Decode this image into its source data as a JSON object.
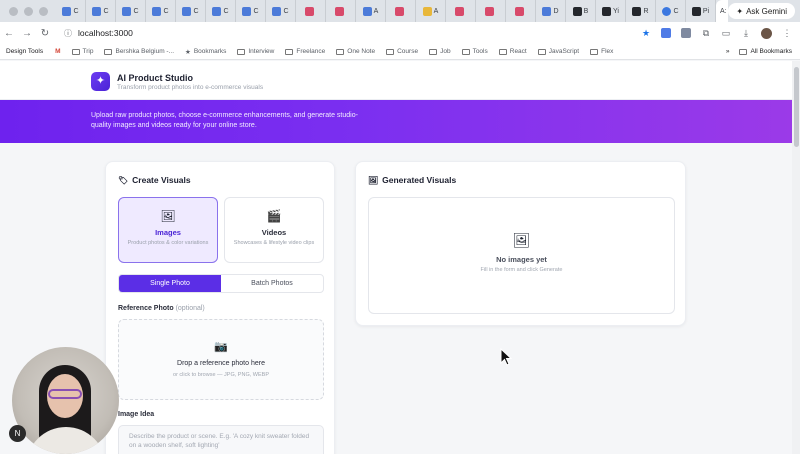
{
  "browser": {
    "tabs": [
      {
        "label": "C",
        "icon": "docs-icon"
      },
      {
        "label": "C",
        "icon": "docs-icon"
      },
      {
        "label": "C",
        "icon": "docs-icon"
      },
      {
        "label": "C",
        "icon": "docs-icon"
      },
      {
        "label": "C",
        "icon": "docs-icon"
      },
      {
        "label": "C",
        "icon": "docs-icon"
      },
      {
        "label": "C",
        "icon": "docs-icon"
      },
      {
        "label": "C",
        "icon": "docs-icon"
      },
      {
        "label": "",
        "icon": "video-icon"
      },
      {
        "label": "",
        "icon": "video-icon"
      },
      {
        "label": "A",
        "icon": "docs-icon"
      },
      {
        "label": "",
        "icon": "video-icon"
      },
      {
        "label": "A",
        "icon": "slides-icon"
      },
      {
        "label": "",
        "icon": "video-icon"
      },
      {
        "label": "",
        "icon": "video-icon"
      },
      {
        "label": "",
        "icon": "video-icon"
      },
      {
        "label": "D",
        "icon": "docs-icon"
      },
      {
        "label": "B",
        "icon": "docs-icon"
      },
      {
        "label": "Yi",
        "icon": "app-icon"
      },
      {
        "label": "R",
        "icon": "app-icon"
      },
      {
        "label": "C",
        "icon": "chrome-icon"
      },
      {
        "label": "Pi",
        "icon": "app-icon"
      }
    ],
    "active_tab": "A:",
    "new_tab": "+",
    "ask_gemini": "Ask Gemini",
    "url": "localhost:3000",
    "bookmarks": [
      {
        "label": "Trip"
      },
      {
        "label": "Bershka Belgium -..."
      },
      {
        "label": "Bookmarks"
      },
      {
        "label": "Interview"
      },
      {
        "label": "Freelance"
      },
      {
        "label": "One Note"
      },
      {
        "label": "Course"
      },
      {
        "label": "Job"
      },
      {
        "label": "Tools"
      },
      {
        "label": "React"
      },
      {
        "label": "JavaScript"
      },
      {
        "label": "Flex"
      }
    ],
    "first_bookmark": "Design Tools",
    "overflow": "»",
    "all_bookmarks": "All Bookmarks"
  },
  "app": {
    "title": "AI Product Studio",
    "subtitle": "Transform product photos into e-commerce visuals",
    "logo_glyph": "✦",
    "banner_text": "Upload raw product photos, choose e-commerce enhancements, and generate studio-quality images and videos ready for your online store."
  },
  "create": {
    "title": "Create Visuals",
    "title_icon": "🏷",
    "types": [
      {
        "label": "Images",
        "desc": "Product photos & color variations",
        "icon": "🖼"
      },
      {
        "label": "Videos",
        "desc": "Showcases & lifestyle video clips",
        "icon": "🎬"
      }
    ],
    "modes": [
      "Single Photo",
      "Batch Photos"
    ],
    "reference_label": "Reference Photo",
    "reference_optional": "(optional)",
    "dropzone_icon": "📷",
    "dropzone_title": "Drop a reference photo here",
    "dropzone_sub": "or click to browse — JPG, PNG, WEBP",
    "idea_label": "Image Idea",
    "idea_placeholder": "Describe the product or scene. E.g. 'A cozy knit sweater folded on a wooden shelf, soft lighting'"
  },
  "generated": {
    "title": "Generated Visuals",
    "title_icon": "🖼",
    "empty_icon": "🖼",
    "empty_title": "No images yet",
    "empty_sub": "Fill in the form and click Generate"
  },
  "webcam": {
    "badge": "N"
  },
  "colors": {
    "accent": "#5b2ee6",
    "banner_start": "#6e22ee",
    "banner_end": "#9b3ae8"
  }
}
